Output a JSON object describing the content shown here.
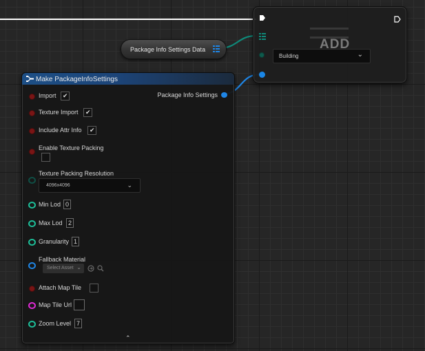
{
  "add_node": {
    "title": "ADD",
    "enum_value": "Building"
  },
  "get_node": {
    "label": "Package Info Settings Data"
  },
  "make_node": {
    "title": "Make PackageInfoSettings",
    "output_label": "Package Info Settings",
    "import_label": "Import",
    "import_checked": true,
    "texture_import_label": "Texture Import",
    "texture_import_checked": true,
    "include_attr_label": "Include Attr Info",
    "include_attr_checked": true,
    "enable_texture_packing_label": "Enable Texture Packing",
    "enable_texture_packing_checked": false,
    "texture_packing_resolution_label": "Texture Packing Resolution",
    "texture_packing_resolution_value": "4096x4096",
    "min_lod_label": "Min Lod",
    "min_lod_value": "0",
    "max_lod_label": "Max Lod",
    "max_lod_value": "2",
    "granularity_label": "Granularity",
    "granularity_value": "1",
    "fallback_material_label": "Fallback Material",
    "fallback_material_placeholder": "Select Asset",
    "attach_map_tile_label": "Attach Map Tile",
    "attach_map_tile_checked": false,
    "map_tile_url_label": "Map Tile Url",
    "map_tile_url_value": "",
    "zoom_level_label": "Zoom Level",
    "zoom_level_value": "7"
  },
  "colors": {
    "exec": "#ffffff",
    "struct_wire": "#0f8a7a",
    "object_wire": "#1f86e6",
    "bool_pin": "#7a1515",
    "int_pin": "#1dbf99",
    "string_pin": "#e02ad6",
    "header_blue": "#1d4f86"
  }
}
